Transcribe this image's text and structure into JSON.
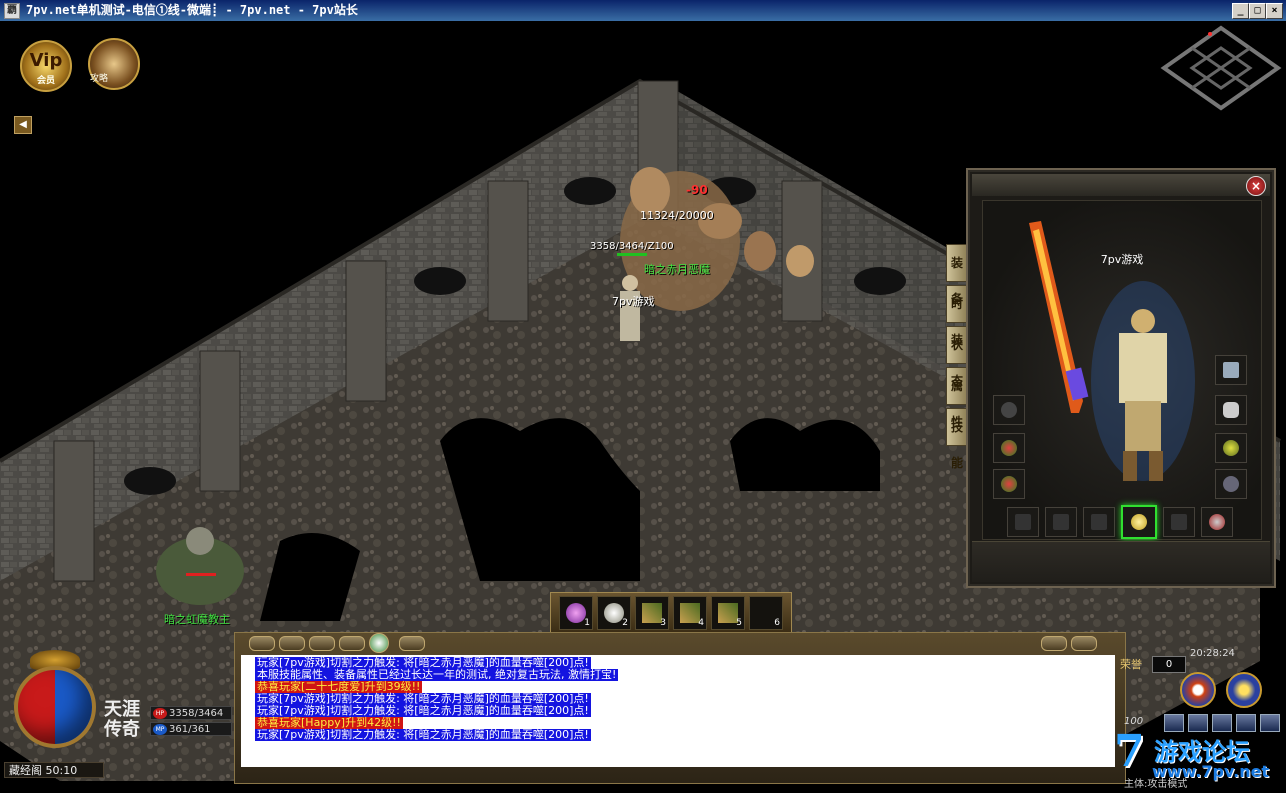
{
  "window": {
    "title": "7pv.net单机测试-电信①线-微端┋ - 7pv.net - 7pv站长",
    "title_prefix": "┋",
    "app_icon": "覇",
    "min_label": "_",
    "max_label": "□",
    "close_label": "×"
  },
  "hud": {
    "vip_label": "Vip",
    "vip_sub": "会员",
    "guide_sub": "攻略",
    "sound_icon": "speaker-icon"
  },
  "scene": {
    "damage_text": "-90",
    "boss_hp": "11324/20000",
    "player_stats": "3358/3464/Z100",
    "boss_name": "暗之赤月恶魔",
    "player_name": "7pv游戏",
    "enemy_name": "暗之虹魔教主"
  },
  "equipment": {
    "char_name": "7pv游戏",
    "close_label": "×",
    "tabs": [
      "装备",
      "时装",
      "状态",
      "属性",
      "技能"
    ]
  },
  "belt": {
    "slots": [
      "1",
      "2",
      "3",
      "4",
      "5",
      "6"
    ]
  },
  "chat": {
    "lines": [
      {
        "type": "blue",
        "text": "玩家[7pv游戏]切割之力触发: 将[暗之赤月恶魔]的血量吞噬[200]点!"
      },
      {
        "type": "blue",
        "text": "本服技能属性、装备属性已经过长达一年的测试, 绝对复古玩法, 激情打宝!"
      },
      {
        "type": "red",
        "text": "恭喜玩家[二十七度爱]升到39级!!"
      },
      {
        "type": "blue",
        "text": "玩家[7pv游戏]切割之力触发: 将[暗之赤月恶魔]的血量吞噬[200]点!"
      },
      {
        "type": "blue",
        "text": "玩家[7pv游戏]切割之力触发: 将[暗之赤月恶魔]的血量吞噬[200]点!"
      },
      {
        "type": "red",
        "text": "恭喜玩家[Happy]升到42级!!"
      },
      {
        "type": "blue",
        "text": "玩家[7pv游戏]切割之力触发: 将[暗之赤月恶魔]的血量吞噬[200]点!"
      }
    ]
  },
  "status": {
    "hp_tag": "HP",
    "mp_tag": "MP",
    "hp": "3358/3464",
    "mp": "361/361",
    "map_coords": "藏经阁 50:10",
    "logo": "天涯传奇",
    "honor_label": "荣誉",
    "honor_value": "0",
    "clock": "20:28:24",
    "percent": "100",
    "bottom_text": "主体:攻击模式"
  },
  "watermark": {
    "digit": "7",
    "text": "游戏论坛",
    "url": "www.7pv.net"
  },
  "colors": {
    "chat_blue": "#1414e0",
    "chat_red": "#d01414",
    "hp_red": "#c81a1a",
    "mp_blue": "#1a5ac8"
  }
}
